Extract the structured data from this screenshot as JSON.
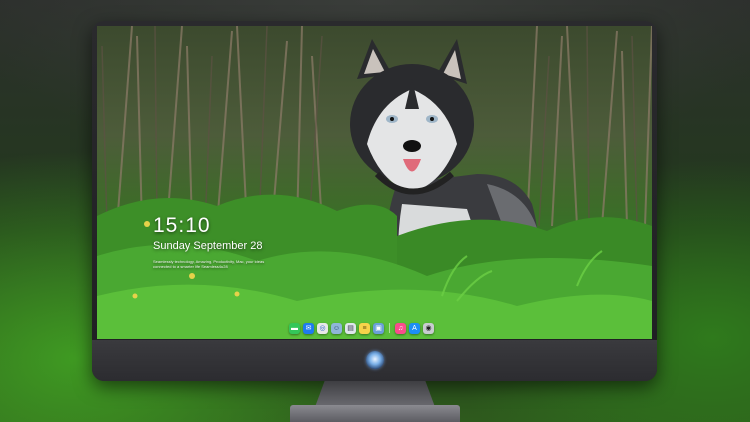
{
  "lock_screen": {
    "time": "15:10",
    "date": "Sunday September 28",
    "tagline": "Seamlessly technology, Amazing, Productivity, Mac, your ideas connected to a smarter life Seamless4u28"
  },
  "dock": {
    "items": [
      {
        "name": "messages-icon",
        "glyph": "▬",
        "color": "#34c759"
      },
      {
        "name": "mail-icon",
        "glyph": "✉",
        "color": "#1e7bf0"
      },
      {
        "name": "safari-icon",
        "glyph": "◎",
        "color": "#e8e8e8"
      },
      {
        "name": "finder-icon",
        "glyph": "☺",
        "color": "#8fb6d8"
      },
      {
        "name": "clapper-icon",
        "glyph": "▤",
        "color": "#dfe6ec"
      },
      {
        "name": "notes-icon",
        "glyph": "≡",
        "color": "#f6d34a"
      },
      {
        "name": "photos-icon",
        "glyph": "▣",
        "color": "#6aa0d8"
      },
      {
        "name": "music-icon",
        "glyph": "♫",
        "color": "#fa4c8c"
      },
      {
        "name": "app-store-icon",
        "glyph": "A",
        "color": "#1c8ef5"
      },
      {
        "name": "camera-icon",
        "glyph": "◉",
        "color": "#c8ccd0"
      }
    ]
  },
  "colors": {
    "dog_fur_dark": "#2a2b2e",
    "dog_fur_light": "#d9dbdc",
    "grass": "#3d9a2a",
    "monitor_bezel": "#1f1f22"
  }
}
